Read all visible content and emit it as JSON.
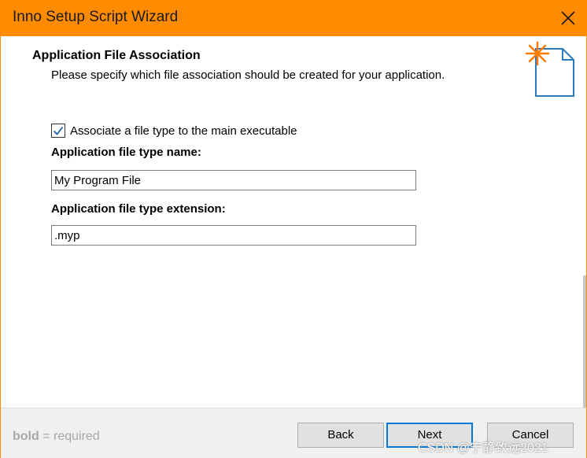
{
  "window": {
    "title": "Inno Setup Script Wizard",
    "accent_color": "#ff8c00"
  },
  "header": {
    "title": "Application File Association",
    "subtitle": "Please specify which file association should be created for your application.",
    "icon": "document-sparkle-icon"
  },
  "form": {
    "associate_checkbox": {
      "label": "Associate a file type to the main executable",
      "checked": true
    },
    "type_name": {
      "label": "Application file type name:",
      "value": "My Program File"
    },
    "type_extension": {
      "label": "Application file type extension:",
      "value": ".myp"
    }
  },
  "footer": {
    "legend_bold": "bold",
    "legend_rest": " = required",
    "back_label": "Back",
    "next_label": "Next",
    "cancel_label": "Cancel"
  },
  "watermark": "CSDN @宁静致远2021"
}
